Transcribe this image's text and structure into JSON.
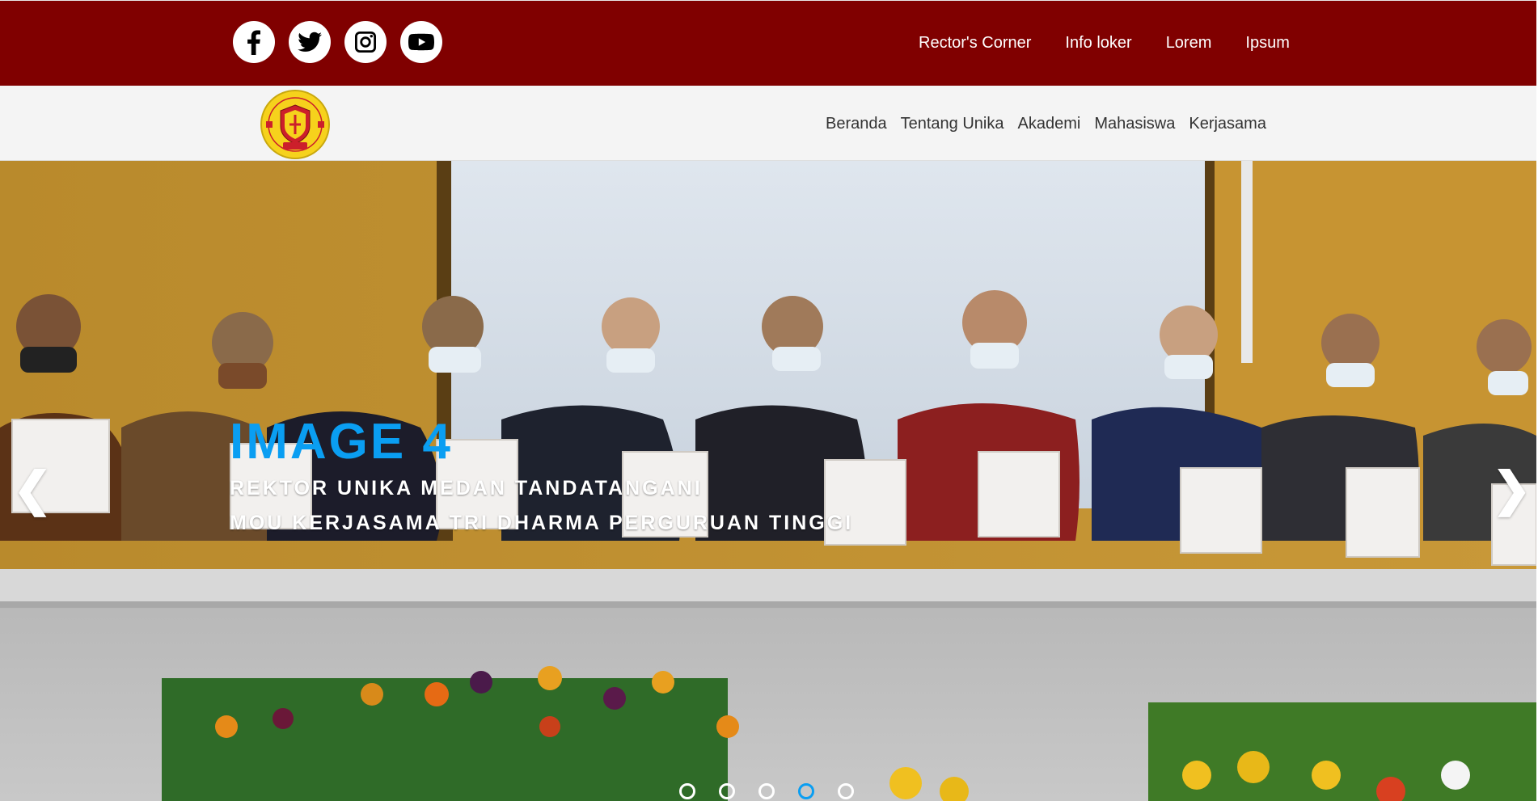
{
  "social": [
    {
      "name": "facebook-icon"
    },
    {
      "name": "twitter-icon"
    },
    {
      "name": "instagram-icon"
    },
    {
      "name": "youtube-icon"
    }
  ],
  "top_nav": [
    "Rector's Corner",
    "Info loker",
    "Lorem",
    "Ipsum"
  ],
  "main_nav": [
    "Beranda",
    "Tentang Unika",
    "Akademi",
    "Mahasiswa",
    "Kerjasama"
  ],
  "logo": {
    "icon": "university-crest-logo"
  },
  "slider": {
    "title": "IMAGE 4",
    "caption_line1": "REKTOR UNIKA MEDAN TANDATANGANI",
    "caption_line2": "MOU KERJASAMA TRI DHARMA PERGURUAN TINGGI",
    "prev_arrow": "❮",
    "next_arrow": "❯",
    "slide_count": 5,
    "active_slide": 4
  },
  "colors": {
    "topbar_bg": "#800000",
    "mainbar_bg": "#f4f4f4",
    "accent_blue": "#0a9ef2",
    "logo_yellow": "#f6d21c",
    "logo_red": "#cc1f2b"
  }
}
